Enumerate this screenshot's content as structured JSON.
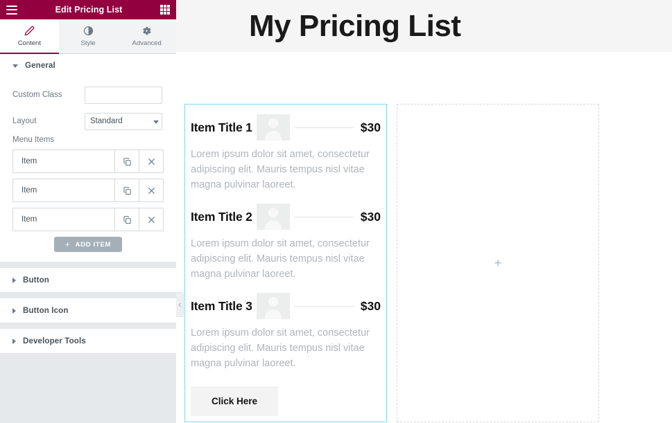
{
  "panel": {
    "header": {
      "title": "Edit Pricing List",
      "menu_icon": "hamburger-icon",
      "apps_icon": "apps-grid-icon"
    },
    "tabs": [
      {
        "label": "Content",
        "icon": "pencil-icon",
        "active": true
      },
      {
        "label": "Style",
        "icon": "contrast-icon",
        "active": false
      },
      {
        "label": "Advanced",
        "icon": "gear-icon",
        "active": false
      }
    ],
    "sections": [
      {
        "label": "General",
        "expanded": true
      },
      {
        "label": "Button",
        "expanded": false
      },
      {
        "label": "Button Icon",
        "expanded": false
      },
      {
        "label": "Developer Tools",
        "expanded": false
      }
    ],
    "general": {
      "custom_class": {
        "label": "Custom Class",
        "value": "",
        "placeholder": ""
      },
      "layout": {
        "label": "Layout",
        "value": "Standard",
        "options": [
          "Standard"
        ]
      },
      "menu_items": {
        "label": "Menu Items",
        "rows": [
          {
            "title": "Item",
            "duplicate_icon": "duplicate-icon",
            "remove_icon": "close-icon"
          },
          {
            "title": "Item",
            "duplicate_icon": "duplicate-icon",
            "remove_icon": "close-icon"
          },
          {
            "title": "Item",
            "duplicate_icon": "duplicate-icon",
            "remove_icon": "close-icon"
          }
        ],
        "add_button": {
          "label": "ADD ITEM",
          "plus": "+"
        }
      }
    },
    "collapse_handle": {
      "icon": "chevron-left-icon"
    }
  },
  "canvas": {
    "page_title": "My Pricing List",
    "widget": {
      "items": [
        {
          "title": "Item Title 1",
          "price": "$30",
          "description": "Lorem ipsum dolor sit amet, consectetur adipiscing elit. Mauris tempus nisl vitae magna pulvinar laoreet.",
          "image": "placeholder-avatar-image"
        },
        {
          "title": "Item Title 2",
          "price": "$30",
          "description": "Lorem ipsum dolor sit amet, consectetur adipiscing elit. Mauris tempus nisl vitae magna pulvinar laoreet.",
          "image": "placeholder-avatar-image"
        },
        {
          "title": "Item Title 3",
          "price": "$30",
          "description": "Lorem ipsum dolor sit amet, consectetur adipiscing elit. Mauris tempus nisl vitae magna pulvinar laoreet.",
          "image": "placeholder-avatar-image"
        }
      ],
      "cta_label": "Click Here"
    },
    "empty_column": {
      "add_icon": "+"
    }
  },
  "colors": {
    "brand": "#93003f",
    "selection": "#7cd8f0",
    "panel_bg": "#e6e9ec",
    "add_button": "#a4afb7",
    "muted_text": "#b0b4b9"
  }
}
